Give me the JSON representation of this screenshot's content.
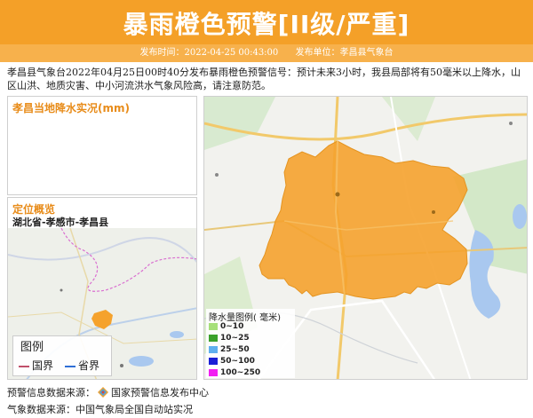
{
  "header": {
    "title": "暴雨橙色预警[II级/严重]",
    "publish_time": "发布时间：2022-04-25 00:43:00",
    "publisher": "发布单位：孝昌县气象台"
  },
  "description": "孝昌县气象台2022年04月25日00时40分发布暴雨橙色预警信号：预计未来3小时，我县局部将有50毫米以上降水，山区山洪、地质灾害、中小河流洪水气象风险高，请注意防范。",
  "rain_panel": {
    "title": "孝昌当地降水实况(mm)"
  },
  "location_panel": {
    "title": "定位概览",
    "path": "湖北省-孝感市-孝昌县",
    "legend_title": "图例",
    "legend_items": [
      {
        "label": "国界",
        "color": "#c0506a"
      },
      {
        "label": "省界",
        "color": "#2f6fd6"
      }
    ]
  },
  "rain_legend": {
    "title": "降水量图例( 毫米)",
    "items": [
      {
        "label": "0~10",
        "color": "#a6e07a"
      },
      {
        "label": "10~25",
        "color": "#3aa12a"
      },
      {
        "label": "25~50",
        "color": "#5fb0ef"
      },
      {
        "label": "50~100",
        "color": "#1a1fd6"
      },
      {
        "label": "100~250",
        "color": "#f21ef2"
      }
    ]
  },
  "footer": {
    "warning_source_prefix": "预警信息数据来源：",
    "warning_source": "国家预警信息发布中心",
    "weather_source": "气象数据来源：中国气象局全国自动站实况"
  },
  "colors": {
    "banner": "#f4a028",
    "subbar": "#f7b14c",
    "warning_region": "#f5a22d",
    "panel_title": "#e88c1a"
  }
}
